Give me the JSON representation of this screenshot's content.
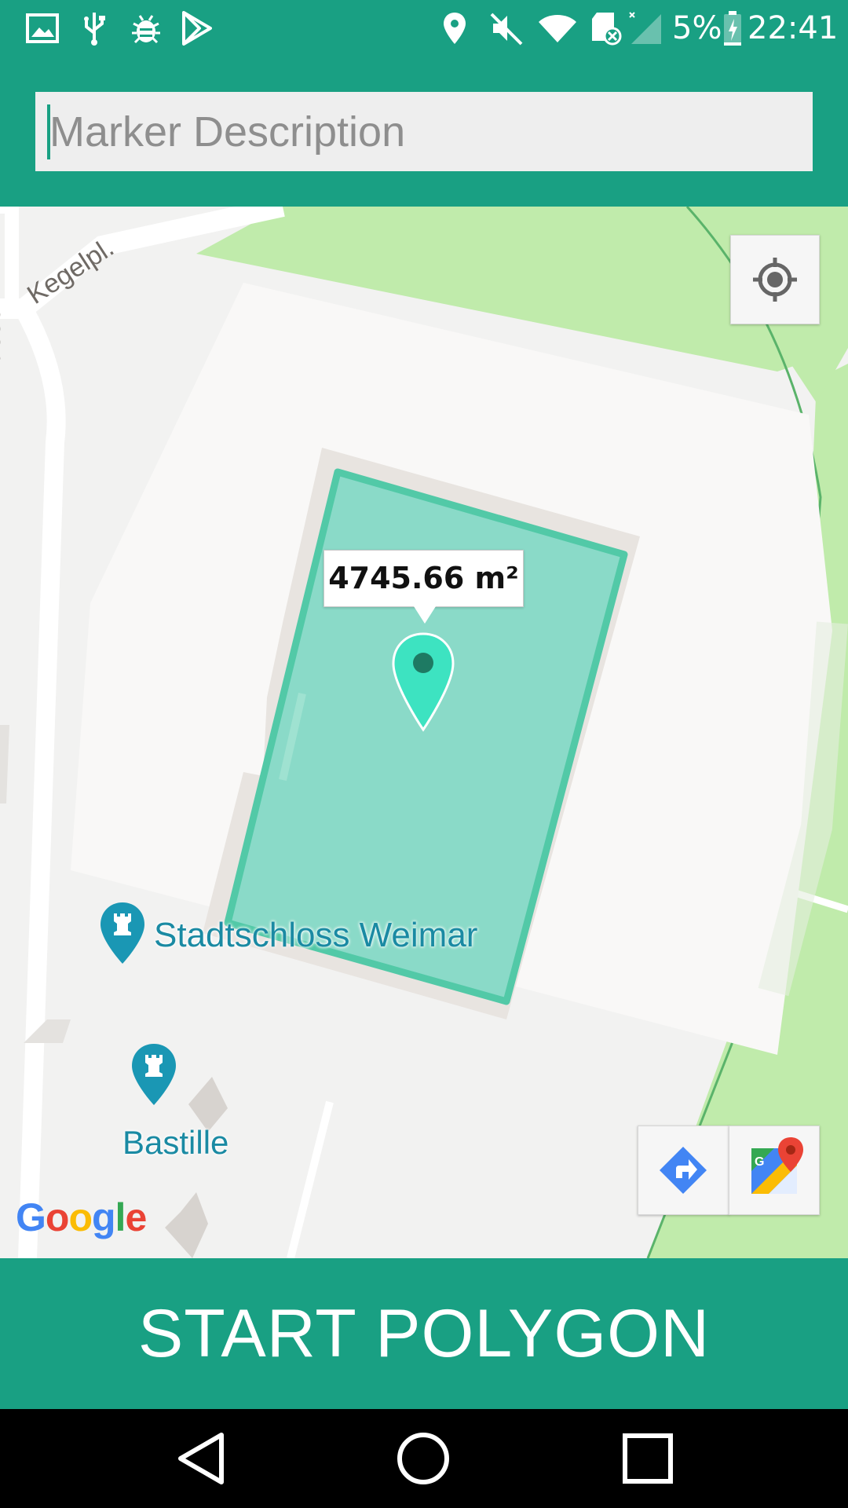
{
  "status_bar": {
    "battery": "5%",
    "time": "22:41",
    "icons": [
      "gallery-icon",
      "usb-icon",
      "debug-icon",
      "play-store-icon",
      "location-icon",
      "mute-icon",
      "wifi-icon",
      "sd-card-icon",
      "signal-icon",
      "battery-icon"
    ]
  },
  "search": {
    "placeholder": "Marker Description",
    "value": ""
  },
  "map": {
    "area_label": "4745.66 m²",
    "streets": [
      "Kegelpl.",
      "asse"
    ],
    "pois": [
      {
        "name": "Stadtschloss Weimar",
        "icon": "castle-icon"
      },
      {
        "name": "Bastille",
        "icon": "castle-icon"
      }
    ],
    "attribution": "Google",
    "polygon_color": "#4fc9a8",
    "marker_color": "#3de3c1"
  },
  "controls": {
    "my_location": "my-location-icon",
    "directions": "directions-icon",
    "open_maps": "google-maps-icon"
  },
  "action": {
    "start_polygon_label": "START POLYGON"
  },
  "nav": {
    "back": "back-icon",
    "home": "home-icon",
    "recents": "recents-icon"
  },
  "colors": {
    "primary": "#19a083",
    "poi": "#1a97b4",
    "park": "#c0ebab"
  }
}
